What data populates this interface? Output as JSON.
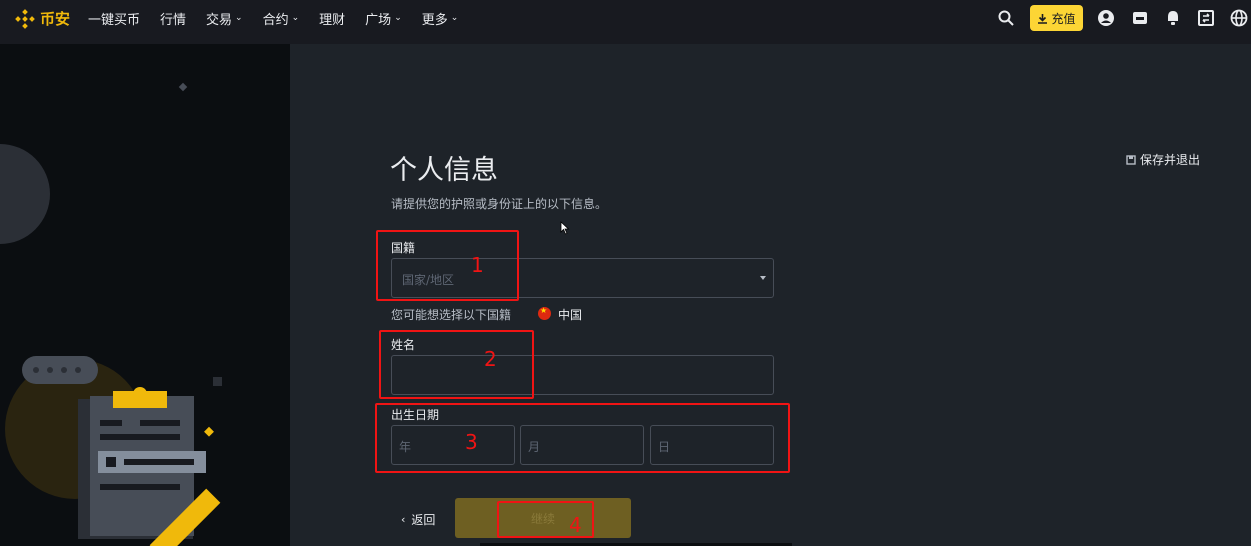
{
  "brand": {
    "name": "币安",
    "color": "#f0b90b"
  },
  "nav": [
    {
      "label": "一键买币",
      "dropdown": false
    },
    {
      "label": "行情",
      "dropdown": false
    },
    {
      "label": "交易",
      "dropdown": true
    },
    {
      "label": "合约",
      "dropdown": true
    },
    {
      "label": "理财",
      "dropdown": false
    },
    {
      "label": "广场",
      "dropdown": true
    },
    {
      "label": "更多",
      "dropdown": true
    }
  ],
  "header_actions": {
    "deposit_label": "充值",
    "icons": [
      "search-icon",
      "download-icon",
      "user-icon",
      "wallet-icon",
      "bell-icon",
      "transfer-icon",
      "globe-icon"
    ]
  },
  "form": {
    "title": "个人信息",
    "subtitle": "请提供您的护照或身份证上的以下信息。",
    "save_exit_label": "保存并退出",
    "nationality": {
      "label": "国籍",
      "placeholder": "国家/地区"
    },
    "suggestion": {
      "text": "您可能想选择以下国籍",
      "option": "中国"
    },
    "name": {
      "label": "姓名",
      "value": ""
    },
    "dob": {
      "label": "出生日期",
      "year_placeholder": "年",
      "month_placeholder": "月",
      "day_placeholder": "日"
    },
    "back_label": "返回",
    "continue_label": "继续"
  },
  "annotations": [
    "1",
    "2",
    "3",
    "4"
  ],
  "colors": {
    "accent": "#fcd535",
    "annotation": "#f01414",
    "bg": "#1e2329",
    "bg_dark": "#0b0e11"
  }
}
